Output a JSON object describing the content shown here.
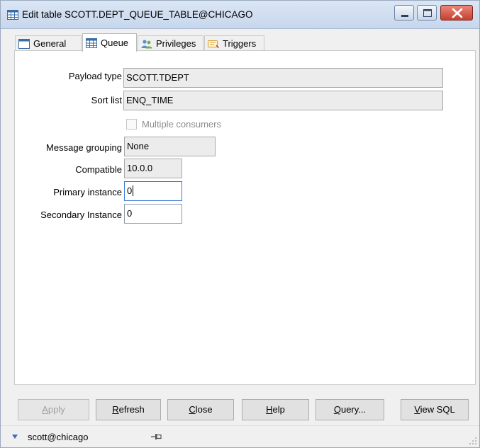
{
  "window": {
    "title": "Edit table SCOTT.DEPT_QUEUE_TABLE@CHICAGO"
  },
  "tabs": [
    {
      "label": "General"
    },
    {
      "label": "Queue"
    },
    {
      "label": "Privileges"
    },
    {
      "label": "Triggers"
    }
  ],
  "form": {
    "payload_type": {
      "label": "Payload type",
      "value": "SCOTT.TDEPT"
    },
    "sort_list": {
      "label": "Sort list",
      "value": "ENQ_TIME"
    },
    "multiple_consumers": {
      "label": "Multiple consumers",
      "checked": false
    },
    "message_grouping": {
      "label": "Message grouping",
      "value": "None"
    },
    "compatible": {
      "label": "Compatible",
      "value": "10.0.0"
    },
    "primary_instance": {
      "label": "Primary instance",
      "value": "0"
    },
    "secondary_instance": {
      "label": "Secondary Instance",
      "value": "0"
    }
  },
  "buttons": {
    "apply": {
      "label": "Apply",
      "mnemonic": "A",
      "rest": "pply"
    },
    "refresh": {
      "label": "Refresh",
      "mnemonic": "R",
      "rest": "efresh"
    },
    "close": {
      "label": "Close",
      "mnemonic": "C",
      "rest": "lose"
    },
    "help": {
      "label": "Help",
      "mnemonic": "H",
      "rest": "elp"
    },
    "query": {
      "label": "Query...",
      "mnemonic": "Q",
      "rest": "uery..."
    },
    "view_sql": {
      "label": "View SQL",
      "mnemonic": "V",
      "rest": "iew SQL"
    }
  },
  "status": {
    "connection": "scott@chicago"
  },
  "colors": {
    "titlebar": "#c7d7ec",
    "close_button": "#c6402d",
    "focus_border": "#3d7bd4"
  }
}
